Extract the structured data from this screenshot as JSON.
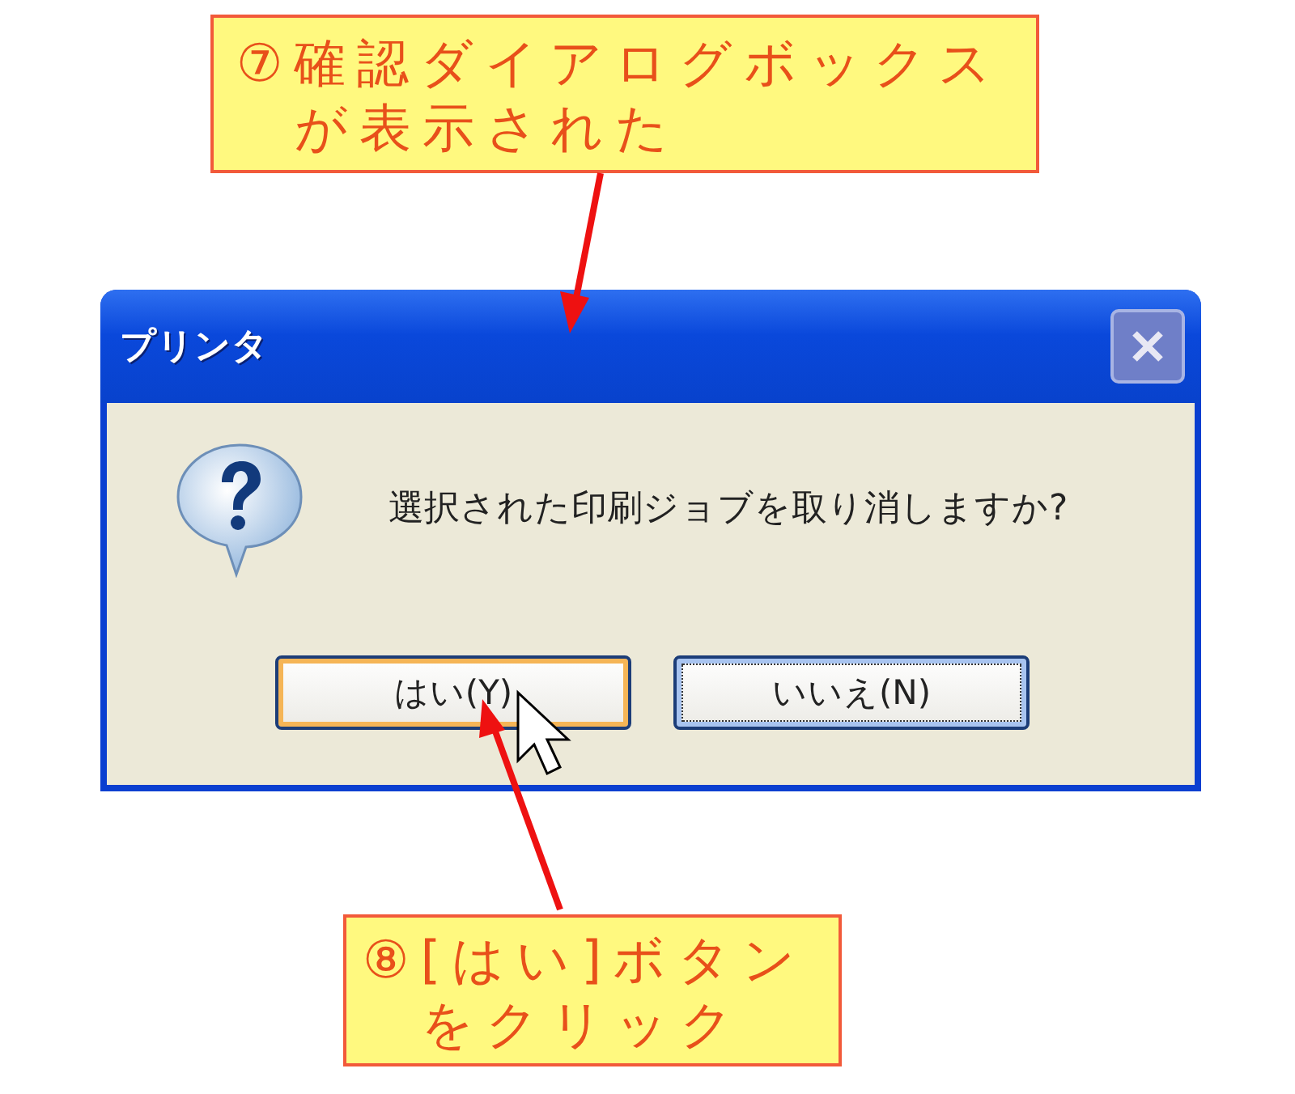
{
  "callouts": [
    {
      "lines": [
        "⑦確認ダイアログボックス",
        "が表示された"
      ]
    },
    {
      "lines": [
        "⑧[はい]ボタン",
        "をクリック"
      ]
    }
  ],
  "dialog": {
    "title": "プリンタ",
    "close_disabled": true,
    "message": "選択された印刷ジョブを取り消しますか?",
    "buttons": [
      {
        "label": "はい(Y)",
        "hovered": true,
        "focused": false
      },
      {
        "label": "いいえ(N)",
        "hovered": false,
        "focused": true
      }
    ]
  }
}
